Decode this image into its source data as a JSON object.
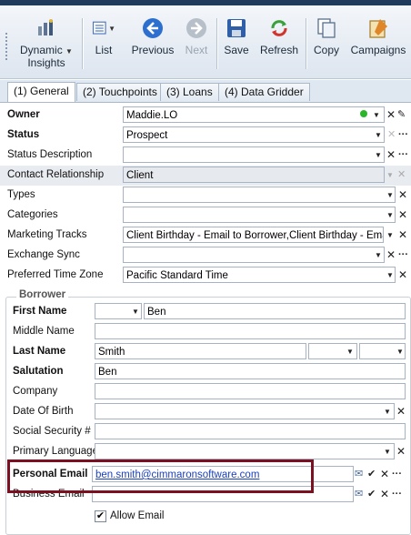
{
  "toolbar": {
    "buttons": [
      {
        "label": "Dynamic Insights",
        "line1": "Dynamic",
        "line2": "Insights",
        "icon": "dynamic-insights-icon"
      },
      {
        "label": "List",
        "icon": "list-icon"
      },
      {
        "label": "Previous",
        "icon": "previous-icon"
      },
      {
        "label": "Next",
        "icon": "next-icon",
        "disabled": true
      },
      {
        "label": "Save",
        "icon": "save-icon"
      },
      {
        "label": "Refresh",
        "icon": "refresh-icon"
      },
      {
        "label": "Copy",
        "icon": "copy-icon"
      },
      {
        "label": "Campaigns",
        "icon": "campaigns-icon"
      }
    ]
  },
  "tabs": [
    {
      "label": "(1) General",
      "active": true
    },
    {
      "label": "(2) Touchpoints"
    },
    {
      "label": "(3) Loans"
    },
    {
      "label": "(4) Data Gridder"
    }
  ],
  "fields": {
    "owner": {
      "label": "Owner",
      "value": "Maddie.LO"
    },
    "status": {
      "label": "Status",
      "value": "Prospect"
    },
    "status_description": {
      "label": "Status Description",
      "value": ""
    },
    "contact_relationship": {
      "label": "Contact Relationship",
      "value": "Client"
    },
    "types": {
      "label": "Types",
      "value": ""
    },
    "categories": {
      "label": "Categories",
      "value": ""
    },
    "marketing_tracks": {
      "label": "Marketing Tracks",
      "value": "Client Birthday - Email to Borrower,Client Birthday - Email..."
    },
    "exchange_sync": {
      "label": "Exchange Sync",
      "value": ""
    },
    "preferred_time_zone": {
      "label": "Preferred Time Zone",
      "value": "Pacific Standard Time"
    }
  },
  "borrower": {
    "group_title": "Borrower",
    "first_name": {
      "label": "First Name",
      "prefix": "",
      "value": "Ben"
    },
    "middle_name": {
      "label": "Middle Name",
      "value": ""
    },
    "last_name": {
      "label": "Last Name",
      "value": "Smith",
      "suffix1": "",
      "suffix2": ""
    },
    "salutation": {
      "label": "Salutation",
      "value": "Ben"
    },
    "company": {
      "label": "Company",
      "value": ""
    },
    "date_of_birth": {
      "label": "Date Of Birth",
      "value": ""
    },
    "ssn": {
      "label": "Social Security #",
      "value": ""
    },
    "primary_language": {
      "label": "Primary Language",
      "value": ""
    },
    "personal_email": {
      "label": "Personal Email",
      "value": "ben.smith@cimmaronsoftware.com"
    },
    "business_email": {
      "label": "Business Email",
      "value": ""
    },
    "allow_email": {
      "label": "Allow Email",
      "checked": true
    }
  },
  "colors": {
    "highlight_border": "#7b1020",
    "status_dot": "#2bb52b",
    "link": "#1a3fbf"
  }
}
